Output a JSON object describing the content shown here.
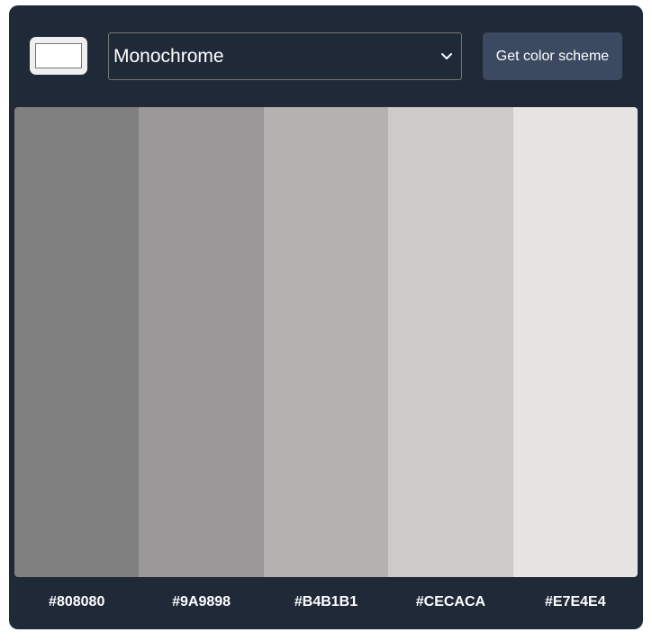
{
  "controls": {
    "seed_color": "#FFFFFF",
    "mode_select": {
      "selected": "Monochrome"
    },
    "get_button_label": "Get color scheme"
  },
  "scheme": {
    "colors": [
      {
        "hex": "#808080",
        "label": "#808080"
      },
      {
        "hex": "#9A9898",
        "label": "#9A9898"
      },
      {
        "hex": "#B4B1B1",
        "label": "#B4B1B1"
      },
      {
        "hex": "#CECACA",
        "label": "#CECACA"
      },
      {
        "hex": "#E7E4E4",
        "label": "#E7E4E4"
      }
    ]
  },
  "theme": {
    "background": "#202938",
    "button_bg": "#3B4A60",
    "text": "#FFFFFF"
  }
}
